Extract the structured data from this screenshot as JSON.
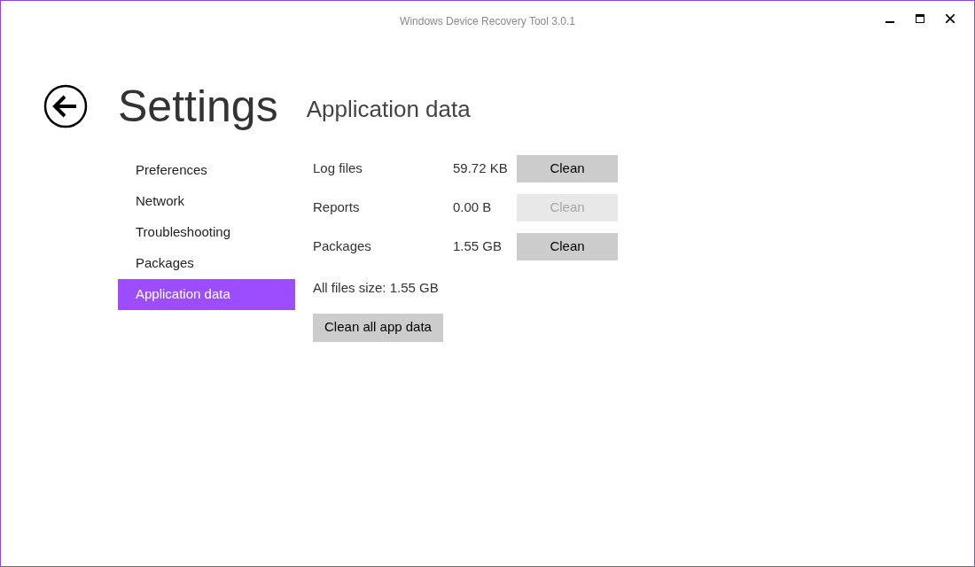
{
  "window": {
    "title": "Windows Device Recovery Tool 3.0.1"
  },
  "header": {
    "title": "Settings",
    "subtitle": "Application data"
  },
  "sidebar": {
    "items": [
      {
        "label": "Preferences",
        "selected": false
      },
      {
        "label": "Network",
        "selected": false
      },
      {
        "label": "Troubleshooting",
        "selected": false
      },
      {
        "label": "Packages",
        "selected": false
      },
      {
        "label": "Application data",
        "selected": true
      }
    ]
  },
  "data_rows": [
    {
      "label": "Log files",
      "size": "59.72 KB",
      "button": {
        "label": "Clean",
        "disabled": false
      }
    },
    {
      "label": "Reports",
      "size": "0.00 B",
      "button": {
        "label": "Clean",
        "disabled": true
      }
    },
    {
      "label": "Packages",
      "size": "1.55 GB",
      "button": {
        "label": "Clean",
        "disabled": false
      }
    }
  ],
  "total": "All files size: 1.55 GB",
  "clean_all_button": {
    "label": "Clean all app data"
  }
}
